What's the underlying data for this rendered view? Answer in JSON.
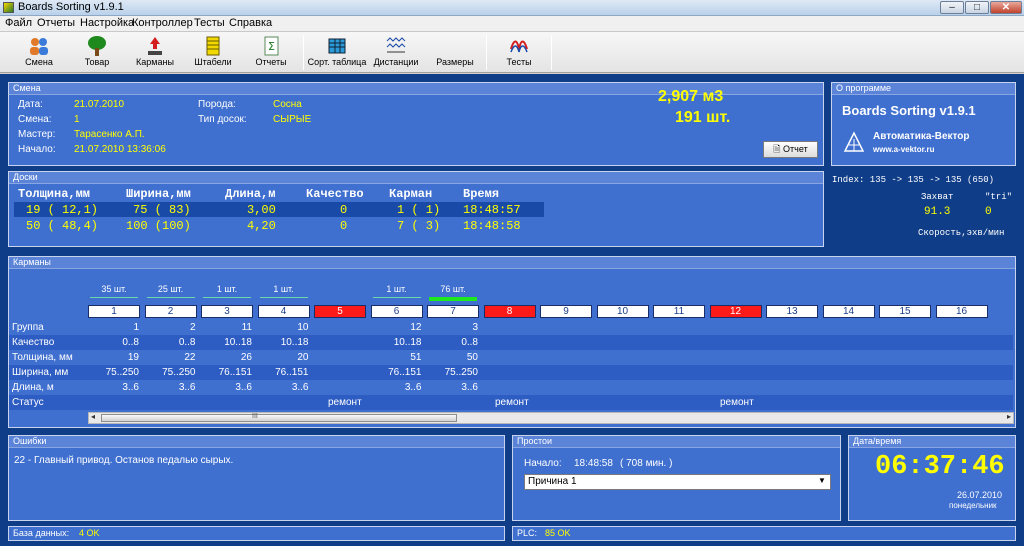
{
  "window": {
    "title": "Boards Sorting v1.9.1"
  },
  "menu": [
    "Файл",
    "Отчеты",
    "Настройка",
    "Контроллер",
    "Тесты",
    "Справка"
  ],
  "toolbar": [
    {
      "label": "Смена",
      "icon": "users-icon"
    },
    {
      "label": "Товар",
      "icon": "tree-icon"
    },
    {
      "label": "Карманы",
      "icon": "pockets-icon"
    },
    {
      "label": "Штабели",
      "icon": "stack-icon"
    },
    {
      "label": "Отчеты",
      "icon": "report-icon"
    },
    {
      "label": "Сорт. таблица",
      "icon": "table-icon"
    },
    {
      "label": "Дистанции",
      "icon": "distance-icon"
    },
    {
      "label": "Размеры",
      "icon": ""
    },
    {
      "label": "Тесты",
      "icon": "tests-icon"
    }
  ],
  "shift": {
    "header": "Смена",
    "date_label": "Дата:",
    "date": "21.07.2010",
    "shift_label": "Смена:",
    "shift": "1",
    "master_label": "Мастер:",
    "master": "Тарасенко А.П.",
    "start_label": "Начало:",
    "start": "21.07.2010 13:36:06",
    "species_label": "Порода:",
    "species": "Сосна",
    "board_type_label": "Тип досок:",
    "board_type": "СЫРЫЕ",
    "volume": "2,907 м3",
    "pieces": "191 шт.",
    "report_button": "Отчет"
  },
  "about": {
    "header": "О программе",
    "product": "Boards Sorting v1.9.1",
    "company": "Автоматика-Вектор",
    "site": "www.a-vektor.ru"
  },
  "boards": {
    "header": "Доски",
    "columns": [
      "Толщина,мм",
      "Ширина,мм",
      "Длина,м",
      "Качество",
      "Карман",
      "Время"
    ],
    "rows": [
      [
        "19 ( 12,1)",
        "75 ( 83)",
        "3,00",
        "0",
        "1 ( 1)",
        "18:48:57"
      ],
      [
        "50 ( 48,4)",
        "100 (100)",
        "4,20",
        "0",
        "7 ( 3)",
        "18:48:58"
      ]
    ],
    "index": "Index: 135 -> 135 -> 135 (650)",
    "capture_label": "Захват",
    "tri_label": "\"tri\"",
    "capture_value": "91.3",
    "tri_value": "0",
    "speed_label": "Скорость,эхв/мин"
  },
  "pockets": {
    "header": "Карманы",
    "numbers": [
      "1",
      "2",
      "3",
      "4",
      "5",
      "6",
      "7",
      "8",
      "9",
      "10",
      "11",
      "12",
      "13",
      "14",
      "15",
      "16"
    ],
    "red": [
      5,
      8,
      12
    ],
    "counts": [
      "35 шт.",
      "25 шт.",
      "1 шт.",
      "1 шт.",
      "",
      "1 шт.",
      "76 шт."
    ],
    "row_labels": [
      "Группа",
      "Качество",
      "Толщина, мм",
      "Ширина, мм",
      "Длина, м",
      "Статус"
    ],
    "group": [
      "1",
      "2",
      "11",
      "10",
      "",
      "12",
      "3"
    ],
    "quality": [
      "0..8",
      "0..8",
      "10..18",
      "10..18",
      "",
      "10..18",
      "0..8"
    ],
    "thickness": [
      "19",
      "22",
      "26",
      "20",
      "",
      "51",
      "50"
    ],
    "width": [
      "75..250",
      "75..250",
      "76..151",
      "76..151",
      "",
      "76..151",
      "75..250"
    ],
    "length": [
      "3..6",
      "3..6",
      "3..6",
      "3..6",
      "",
      "3..6",
      "3..6"
    ],
    "status": [
      "ремонт",
      "ремонт",
      "ремонт"
    ],
    "scroll_grip": "III"
  },
  "errors": {
    "header": "Ошибки",
    "message": "22 - Главный привод. Останов педалью сырых."
  },
  "downtime": {
    "header": "Простои",
    "start_label": "Начало:",
    "start": "18:48:58",
    "duration": "( 708 мин. )",
    "reason": "Причина 1"
  },
  "datetime": {
    "header": "Дата/время",
    "time": "06:37:46",
    "date": "26.07.2010",
    "weekday": "понедельник"
  },
  "status": {
    "db_label": "База данных:",
    "db_value": "4 OK",
    "plc_label": "PLC:",
    "plc_value": "85 OK"
  }
}
